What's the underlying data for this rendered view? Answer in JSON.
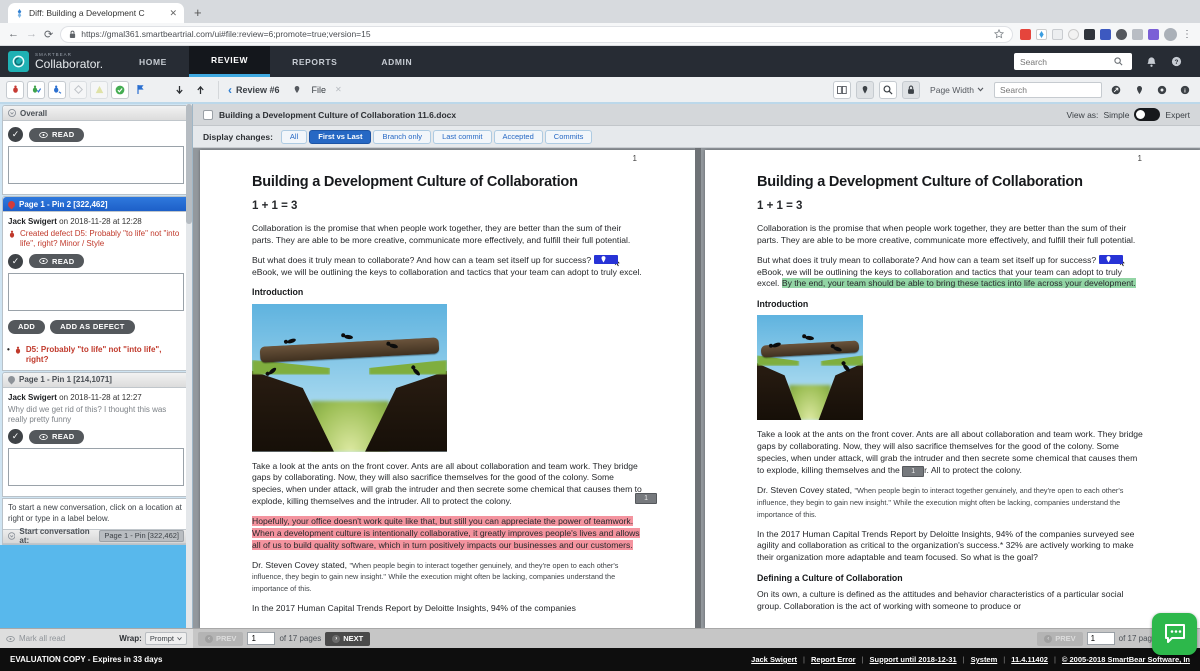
{
  "colors": {
    "accent": "#2668c4",
    "added_highlight": "#93d5a5",
    "removed_highlight": "#f4949f",
    "pin_blue": "#2733d6",
    "nav_bg": "#272c34",
    "sidebar_blue": "#58b8ec",
    "chat_green": "#2db84b"
  },
  "browser": {
    "tab_title": "Diff: Building a Development C",
    "url": "https://gmal361.smartbeartrial.com/ui#file:review=6;promote=true;version=15"
  },
  "nav": {
    "brand_small": "SMARTBEAR",
    "brand": "Collaborator.",
    "items": [
      {
        "label": "HOME"
      },
      {
        "label": "REVIEW"
      },
      {
        "label": "REPORTS"
      },
      {
        "label": "ADMIN"
      }
    ],
    "search_placeholder": "Search"
  },
  "toolbar": {
    "review": "Review #6",
    "file": "File",
    "page_width": "Page Width",
    "search_placeholder": "Search"
  },
  "sidebar": {
    "overall": "Overall",
    "read": "READ",
    "thread_pin2": {
      "title": "Page 1 - Pin 2 [322,462]",
      "author": "Jack Swigert",
      "meta": "on 2018-11-28 at 12:28",
      "defect": "Created defect D5: Probably \"to life\" not \"into life\", right? Minor / Style",
      "add": "ADD",
      "add_as_defect": "ADD AS DEFECT",
      "defect_item": "D5: Probably \"to life\" not \"into life\", right?"
    },
    "thread_pin1": {
      "title": "Page 1 - Pin 1 [214,1071]",
      "author": "Jack Swigert",
      "meta": "on 2018-11-28 at 12:27",
      "comment": "Why did we get rid of this? I thought this was really pretty funny"
    },
    "hint": "To start a new conversation, click on a location at right or type in a label below.",
    "start_label": "Start conversation at:",
    "start_chip": "Page 1 - Pin  [322,462]"
  },
  "docbar": {
    "filename": "Building a Development Culture of Collaboration 11.6.docx",
    "view_as": "View as:",
    "simple": "Simple",
    "expert": "Expert",
    "display_label": "Display changes:",
    "options": [
      {
        "label": "All"
      },
      {
        "label": "First vs Last"
      },
      {
        "label": "Branch only"
      },
      {
        "label": "Last commit"
      },
      {
        "label": "Accepted"
      },
      {
        "label": "Commits"
      }
    ]
  },
  "doc": {
    "page_number": "1",
    "title": "Building a Development Culture of Collaboration",
    "equation": "1 + 1 = 3",
    "p1": "Collaboration is the promise that when people work together, they are better than the sum of their parts. They are able to be more creative, communicate more effectively, and fulfill their full potential.",
    "p2a": "But what does it truly mean to collaborate? And how can a team set itself up for success?",
    "p2b": "eBook, we will be outlining the keys to collaboration and tactics that your team can adopt to truly excel.",
    "p2_added": "By the end, your team should be able to bring these tactics into life across your development.",
    "intro": "Introduction",
    "ants_left": "Take a look at the ants on the front cover. Ants are all about collaboration and team work. They bridge gaps by collaborating. Now, they will also sacrifice themselves for the good of the colony. Some species, when under attack, will grab the intruder and then secrete some chemical that causes them to explode, killing themselves and the intruder. All to protect the colony.",
    "ants_right_a": "Take a look at the ants on the front cover. Ants are all about collaboration and team work. They bridge gaps by collaborating. Now, they will also sacrifice themselves for the good of the colony. Some species, when under attack, will grab the intruder and then secrete some chemical that causes them to explode, killing themselves and the",
    "ants_right_b": "r. All to protect the colony.",
    "pin1_label": "1",
    "removed": "Hopefully, your office doesn't work quite like that, but still you can appreciate the power of teamwork. When a development culture is intentionally collaborative, it greatly improves people's lives and allows all of us to build quality software, which in turn positively impacts our businesses and our customers.",
    "covey_a": "Dr. Steven Covey stated,",
    "covey_quote": "\"When people begin to interact together genuinely, and they're open to each other's influence, they begin to gain new insight.\"",
    "covey_b": "While the execution might often be lacking, companies understand the importance of this.",
    "trends_left": "In the 2017 Human Capital Trends Report by Deloitte Insights, 94% of the companies",
    "trends_right": "In the 2017 Human Capital Trends Report by Deloitte Insights, 94% of the companies surveyed see agility and collaboration as critical to the organization's success.* 32% are actively working to make their organization more adaptable and team focused. So what is the goal?",
    "defining": "Defining a Culture of Collaboration",
    "defining_p": "On its own, a culture is defined as the attitudes and behavior characteristics of a particular social group. Collaboration is the act of working with someone to produce or"
  },
  "footer": {
    "mark_all_read": "Mark all read",
    "wrap": "Wrap:",
    "wrap_value": "Prompt",
    "prev": "PREV",
    "next": "NEXT",
    "page": "1",
    "of_pages": "of 17 pages",
    "of_pages_right": "of 17 pag"
  },
  "statusbar": {
    "eval": "EVALUATION COPY - Expires in 33 days",
    "links": [
      {
        "label": "Jack Swigert"
      },
      {
        "label": "Report Error"
      },
      {
        "label": "Support until 2018-12-31"
      },
      {
        "label": "System"
      },
      {
        "label": "11.4.11402"
      },
      {
        "label": "© 2005-2018 SmartBear Software, In"
      }
    ]
  }
}
